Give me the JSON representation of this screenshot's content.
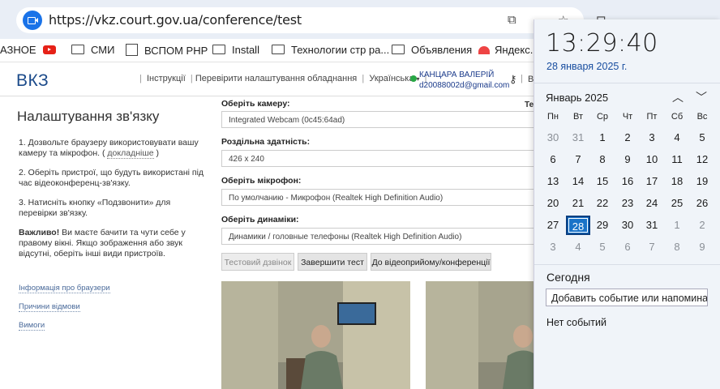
{
  "browser": {
    "url": "https://vkz.court.gov.ua/conference/test",
    "bookmarks": [
      {
        "label": "АЗНОЕ",
        "icon": "none"
      },
      {
        "label": "",
        "icon": "youtube-icon"
      },
      {
        "label": "СМИ",
        "icon": "folder-icon"
      },
      {
        "label": "ВСПОМ PHP",
        "icon": "php-icon"
      },
      {
        "label": "Install",
        "icon": "folder-icon"
      },
      {
        "label": "Технологии стр ра...",
        "icon": "folder-icon"
      },
      {
        "label": "Объявления",
        "icon": "folder-icon"
      },
      {
        "label": "Яндекс.П",
        "icon": "umbrella-icon"
      }
    ]
  },
  "site": {
    "logo": "ВКЗ",
    "nav": {
      "instructions": "Інструкції",
      "check_equipment": "Перевірити налаштування обладнання",
      "language": "Українська",
      "user_name": "КАНЦАРА ВАЛЕРІЙ",
      "user_email": "d20088002d@gmail.com",
      "cut_item": "В"
    },
    "sidebar": {
      "title": "Налаштування зв'язку",
      "step1": "1. Дозвольте браузеру використовувати вашу камеру та мікрофон.",
      "step1_link": "докладніше",
      "step2": "2. Оберіть пристрої, що будуть використані під час відеоконференц-зв'язку.",
      "step3": "3. Натисніть кнопку «Подзвонити» для перевірки зв'язку.",
      "step4_bold": "Важливо!",
      "step4": "Ви маєте бачити та чути себе у правому вікні. Якщо зображення або звук відсутні, оберіть інші види пристроїв.",
      "links": [
        "Інформація про браузери",
        "Причини відмови",
        "Вимоги"
      ]
    },
    "form": {
      "camera_label": "Оберіть камеру:",
      "camera_value": "Integrated Webcam (0c45:64ad)",
      "camera_extra": "Те",
      "resolution_label": "Роздільна здатність:",
      "resolution_value": "426 x 240",
      "mic_label": "Оберіть мікрофон:",
      "mic_value": "По умолчанию - Микрофон (Realtek High Definition Audio)",
      "speaker_label": "Оберіть динаміки:",
      "speaker_value": "Динамики / головные телефоны (Realtek High Definition Audio)"
    },
    "buttons": {
      "test_call": "Тестовий дзвінок",
      "end_test": "Завершити тест",
      "to_reception": "До відеоприйому/конференції"
    }
  },
  "calendar": {
    "time": "13:29:40",
    "date": "28 января 2025 г.",
    "month": "Январь 2025",
    "weekdays": [
      "Пн",
      "Вт",
      "Ср",
      "Чт",
      "Пт",
      "Сб",
      "Вс"
    ],
    "days": [
      [
        30,
        31,
        1,
        2,
        3,
        4,
        5
      ],
      [
        6,
        7,
        8,
        9,
        10,
        11,
        12
      ],
      [
        13,
        14,
        15,
        16,
        17,
        18,
        19
      ],
      [
        20,
        21,
        22,
        23,
        24,
        25,
        26
      ],
      [
        27,
        28,
        29,
        30,
        31,
        1,
        2
      ],
      [
        3,
        4,
        5,
        6,
        7,
        8,
        9
      ]
    ],
    "today": 28,
    "today_label": "Сегодня",
    "add_event": "Добавить событие или напомина",
    "no_events": "Нет событий"
  }
}
